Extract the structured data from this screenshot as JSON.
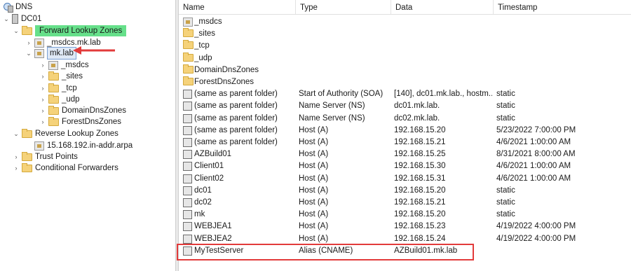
{
  "tree": {
    "root": "DNS",
    "server": "DC01",
    "forward": "Forward Lookup Zones",
    "msdcs_zone": "_msdcs.mk.lab",
    "mklab": "mk.lab",
    "mklab_children": [
      "_msdcs",
      "_sites",
      "_tcp",
      "_udp",
      "DomainDnsZones",
      "ForestDnsZones"
    ],
    "reverse": "Reverse Lookup Zones",
    "reverse_zone": "15.168.192.in-addr.arpa",
    "trust": "Trust Points",
    "cond": "Conditional Forwarders"
  },
  "columns": [
    "Name",
    "Type",
    "Data",
    "Timestamp"
  ],
  "rows": [
    {
      "name": "_msdcs",
      "type": "",
      "data": "",
      "ts": "",
      "icon": "zone-folder"
    },
    {
      "name": "_sites",
      "type": "",
      "data": "",
      "ts": "",
      "icon": "folder"
    },
    {
      "name": "_tcp",
      "type": "",
      "data": "",
      "ts": "",
      "icon": "folder"
    },
    {
      "name": "_udp",
      "type": "",
      "data": "",
      "ts": "",
      "icon": "folder"
    },
    {
      "name": "DomainDnsZones",
      "type": "",
      "data": "",
      "ts": "",
      "icon": "folder"
    },
    {
      "name": "ForestDnsZones",
      "type": "",
      "data": "",
      "ts": "",
      "icon": "folder"
    },
    {
      "name": "(same as parent folder)",
      "type": "Start of Authority (SOA)",
      "data": "[140], dc01.mk.lab., hostm...",
      "ts": "static",
      "icon": "record"
    },
    {
      "name": "(same as parent folder)",
      "type": "Name Server (NS)",
      "data": "dc01.mk.lab.",
      "ts": "static",
      "icon": "record"
    },
    {
      "name": "(same as parent folder)",
      "type": "Name Server (NS)",
      "data": "dc02.mk.lab.",
      "ts": "static",
      "icon": "record"
    },
    {
      "name": "(same as parent folder)",
      "type": "Host (A)",
      "data": "192.168.15.20",
      "ts": "5/23/2022 7:00:00 PM",
      "icon": "record"
    },
    {
      "name": "(same as parent folder)",
      "type": "Host (A)",
      "data": "192.168.15.21",
      "ts": "4/6/2021 1:00:00 AM",
      "icon": "record"
    },
    {
      "name": "AZBuild01",
      "type": "Host (A)",
      "data": "192.168.15.25",
      "ts": "8/31/2021 8:00:00 AM",
      "icon": "record"
    },
    {
      "name": "Client01",
      "type": "Host (A)",
      "data": "192.168.15.30",
      "ts": "4/6/2021 1:00:00 AM",
      "icon": "record"
    },
    {
      "name": "Client02",
      "type": "Host (A)",
      "data": "192.168.15.31",
      "ts": "4/6/2021 1:00:00 AM",
      "icon": "record"
    },
    {
      "name": "dc01",
      "type": "Host (A)",
      "data": "192.168.15.20",
      "ts": "static",
      "icon": "record"
    },
    {
      "name": "dc02",
      "type": "Host (A)",
      "data": "192.168.15.21",
      "ts": "static",
      "icon": "record"
    },
    {
      "name": "mk",
      "type": "Host (A)",
      "data": "192.168.15.20",
      "ts": "static",
      "icon": "record"
    },
    {
      "name": "WEBJEA1",
      "type": "Host (A)",
      "data": "192.168.15.23",
      "ts": "4/19/2022 4:00:00 PM",
      "icon": "record"
    },
    {
      "name": "WEBJEA2",
      "type": "Host (A)",
      "data": "192.168.15.24",
      "ts": "4/19/2022 4:00:00 PM",
      "icon": "record"
    },
    {
      "name": "MyTestServer",
      "type": "Alias (CNAME)",
      "data": "AZBuild01.mk.lab",
      "ts": "",
      "icon": "record"
    }
  ],
  "colors": {
    "highlight_green": "#66e08a",
    "annotation_red": "#e23b3b"
  }
}
